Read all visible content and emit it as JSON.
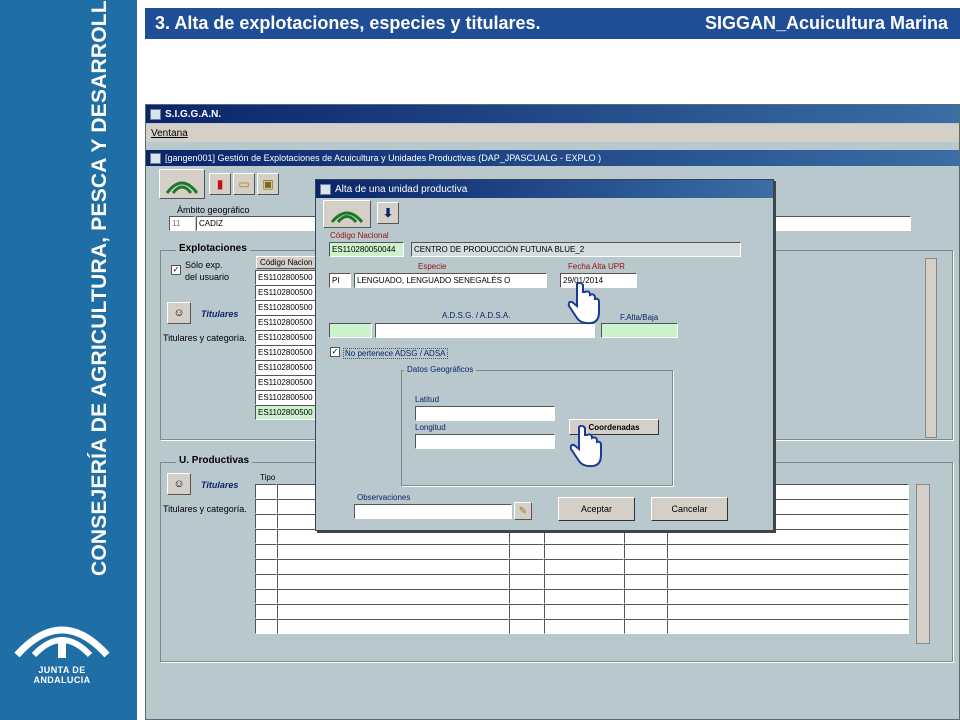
{
  "slide": {
    "section_title": "3. Alta de explotaciones, especies y titulares.",
    "product": "SIGGAN_Acuicultura Marina"
  },
  "sidebar": {
    "vertical_text": "CONSEJERÍA DE AGRICULTURA, PESCA Y DESARROLLO RURAL",
    "logo_label": "JUNTA DE ANDALUCIA"
  },
  "app": {
    "title": "S.I.G.G.A.N.",
    "menu_ventana": "Ventana",
    "form_title": "[gangen001] Gestión de Explotaciones de Acuicultura y Unidades Productivas (DAP_JPASCUALG - EXPLO )",
    "ambito_label": "Ámbito geográfico",
    "ambito_code": "11",
    "ambito_name": "CADIZ",
    "explotaciones": {
      "title": "Explotaciones",
      "solo_exp_label": "Sólo exp.",
      "solo_exp_label2": "del usuario",
      "col_codigo": "Código Nacion",
      "rows": [
        "ES1102800500",
        "ES1102800500",
        "ES1102800500",
        "ES1102800500",
        "ES1102800500",
        "ES1102800500",
        "ES1102800500",
        "ES1102800500",
        "ES1102800500",
        "ES1102800500"
      ],
      "titulares_link": "Titulares",
      "titulares_cat": "Titulares y categoría."
    },
    "productivas": {
      "title": "U. Productivas",
      "col_tipo": "Tipo",
      "titulares_link": "Titulares",
      "titulares_cat": "Titulares y categoría."
    }
  },
  "modal": {
    "title": "Alta de una unidad productiva",
    "codigo_label": "Código Nacional",
    "codigo_value": "ES110280050044",
    "codigo_desc": "CENTRO DE PRODUCCIÓN FUTUNA BLUE_2",
    "especie_label": "Especie",
    "especie_code": "PI",
    "especie_name": "LENGUADO, LENGUADO SENEGALÉS O",
    "fecha_label": "Fecha Alta UPR",
    "fecha_value": "29/01/2014",
    "adsg_label": "A.D.S.G. / A.D.S.A.",
    "fbaja_label": "F.Alta/Baja",
    "no_pertenece_label": "No pertenece ADSG / ADSA",
    "no_pertenece_checked": true,
    "geo_title": "Datos Geográficos",
    "latitud_label": "Latitud",
    "longitud_label": "Longitud",
    "coordenadas_btn": "Coordenadas",
    "observaciones_label": "Observaciones",
    "aceptar_btn": "Aceptar",
    "cancelar_btn": "Cancelar"
  },
  "colors": {
    "slide_band": "#1f6fa6",
    "topbar": "#1f4e97",
    "window_bg": "#b8c8cc",
    "titlebar": "#0a246a",
    "field_green": "#ccf2cc"
  }
}
